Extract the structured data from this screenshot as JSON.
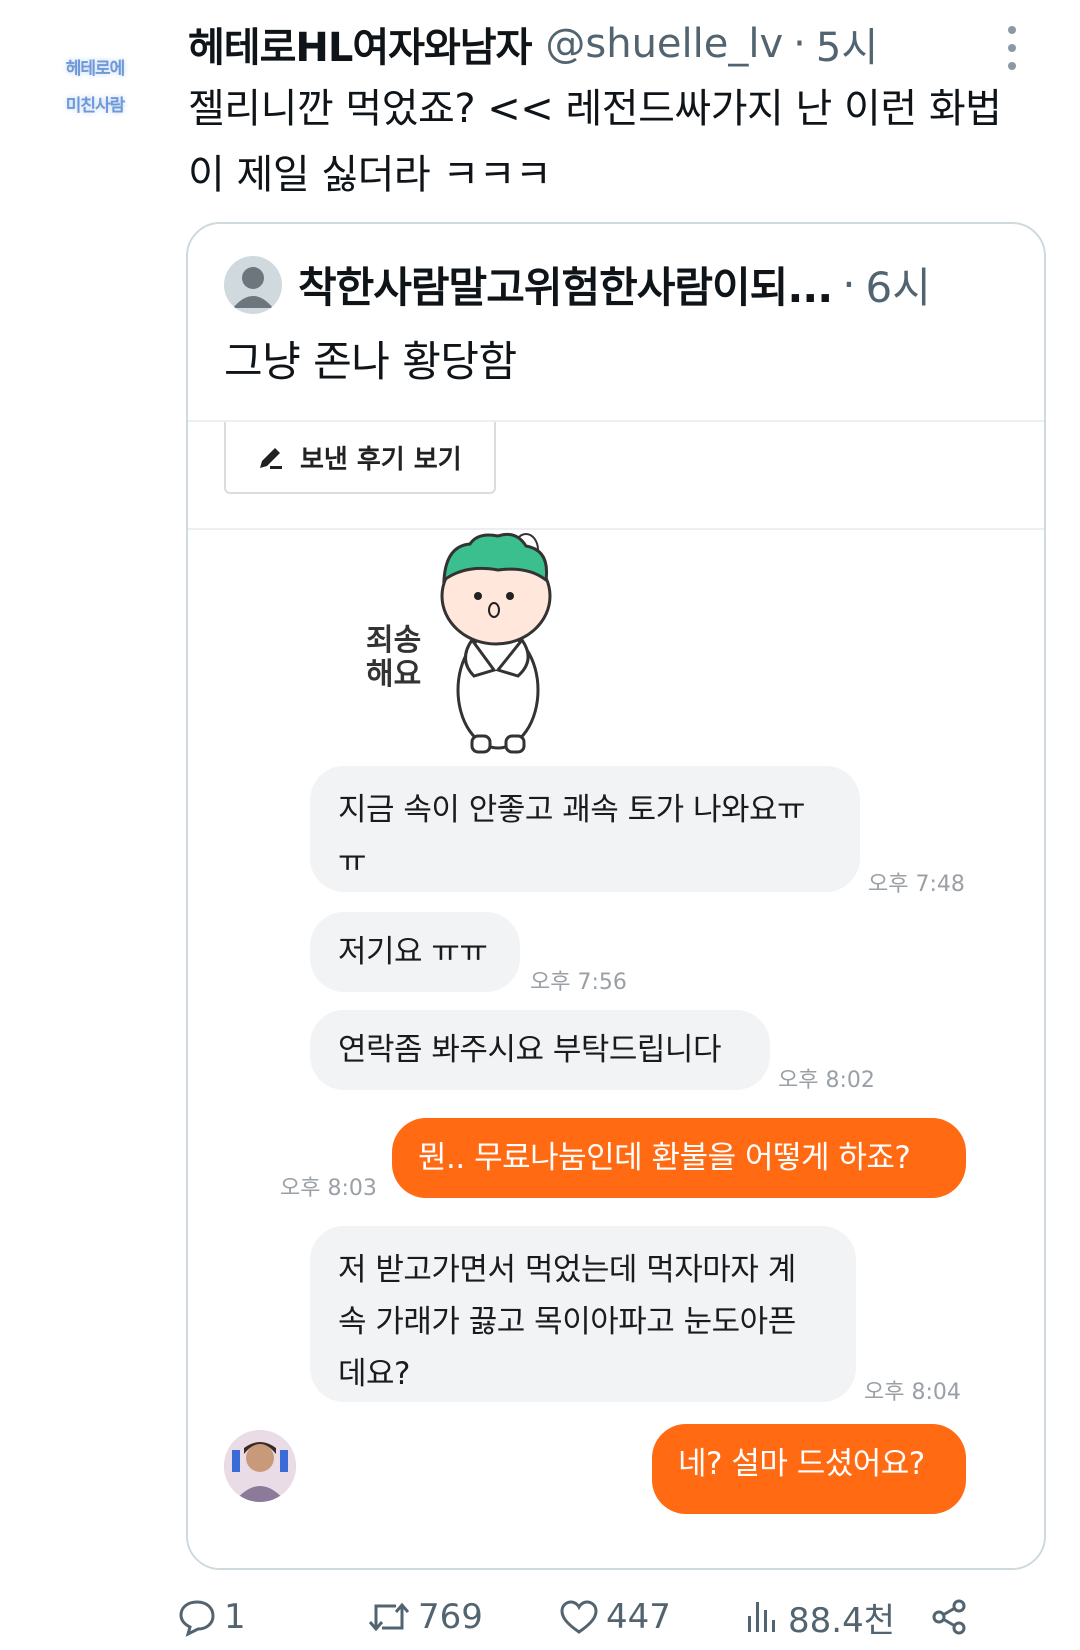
{
  "tweet": {
    "avatar_text_1": "헤테로에",
    "avatar_text_2": "미친사람",
    "author_name": "헤테로HL여자와남자",
    "author_handle": "@shuelle_lv",
    "separator": "·",
    "time": "5시",
    "text": "젤리니깐 먹었죠? << 레전드싸가지 난 이런 화법이 제일 싫더라 ㅋㅋㅋ"
  },
  "quote": {
    "author_name": "착한사람말고위험한사람이되...",
    "separator": "·",
    "time": "6시",
    "text": "그냥 존나 황당함"
  },
  "screenshot": {
    "review_button_label": "보낸 후기 보기",
    "sticker_text_1": "죄송",
    "sticker_text_2": "해요",
    "messages": [
      {
        "text_line1": "지금 속이 안좋고 괘속 토가 나와요ㅠ",
        "text_line2": "ㅠ",
        "time": "오후 7:48"
      },
      {
        "text": "저기요 ㅠㅠ",
        "time": "오후 7:56"
      },
      {
        "text": "연락좀 봐주시요 부탁드립니다",
        "time": "오후 8:02"
      },
      {
        "text": "뭔.. 무료나눔인데 환불을 어떻게 하죠?",
        "time": "오후 8:03"
      },
      {
        "line1": "저 받고가면서 먹었는데 먹자마자 계",
        "line2": "속 가래가 끓고 목이아파고 눈도아픈",
        "line3": "데요?",
        "time": "오후 8:04"
      },
      {
        "text": "네? 설마 드셨어요?"
      }
    ],
    "colors": {
      "outgoing_bubble": "#ff6a13",
      "incoming_bubble": "#f2f3f5"
    }
  },
  "actions": {
    "replies": "1",
    "retweets": "769",
    "likes": "447",
    "views": "88.4천"
  }
}
